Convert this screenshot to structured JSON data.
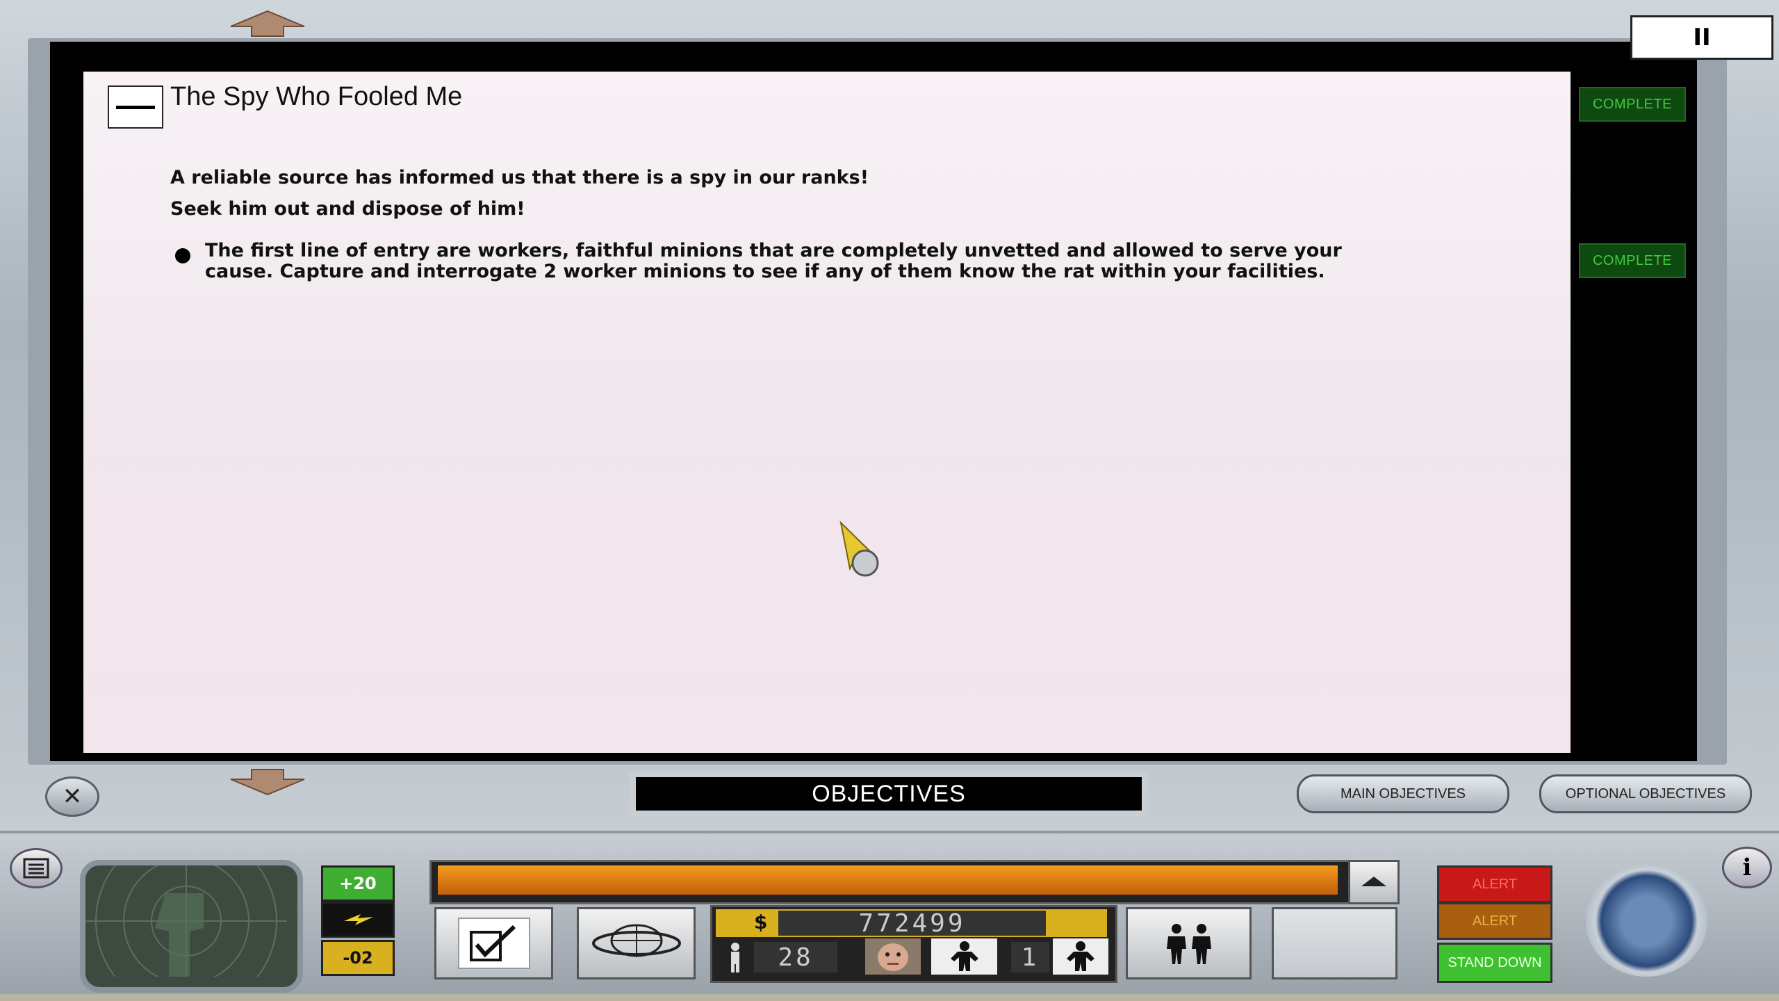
{
  "window": {
    "pause_symbol": "II",
    "close_symbol": "✕"
  },
  "mission": {
    "collapse_symbol": "—",
    "title": "The Spy Who Fooled Me",
    "description_line1": "A reliable source has informed us that there is a spy in our ranks!",
    "description_line2": "Seek him out and dispose of him!",
    "tasks": [
      {
        "text": "The first line of entry are workers, faithful minions that are completely unvetted and allowed to serve your cause. Capture and interrogate 2 worker minions to see if any of them know the rat within your facilities."
      }
    ],
    "status": [
      "COMPLETE",
      "COMPLETE"
    ]
  },
  "bottom_bar": {
    "panel_title": "OBJECTIVES",
    "main_objectives_label": "MAIN OBJECTIVES",
    "optional_objectives_label": "OPTIONAL OBJECTIVES"
  },
  "hud": {
    "stat_top": "+20",
    "stat_bottom": "-02",
    "currency_symbol": "$",
    "money": "772499",
    "minions_count": "28",
    "secondary_count": "1",
    "alert_red_label": "ALERT",
    "alert_amber_label": "ALERT",
    "stand_down_label": "STAND DOWN",
    "info_symbol": "i",
    "colors": {
      "alert_red": "#c81818",
      "alert_amber": "#c07010",
      "stand_down_green": "#3fc030",
      "progress_orange": "#f08a14",
      "complete_green": "#43c740"
    },
    "icons": [
      "menu-icon",
      "radar-icon",
      "lightning-icon",
      "checkmark-icon",
      "globe-icon",
      "minion-icon",
      "henchman-portrait-icon",
      "agent-icon",
      "minions-pair-icon",
      "dial-icon",
      "info-icon"
    ]
  }
}
